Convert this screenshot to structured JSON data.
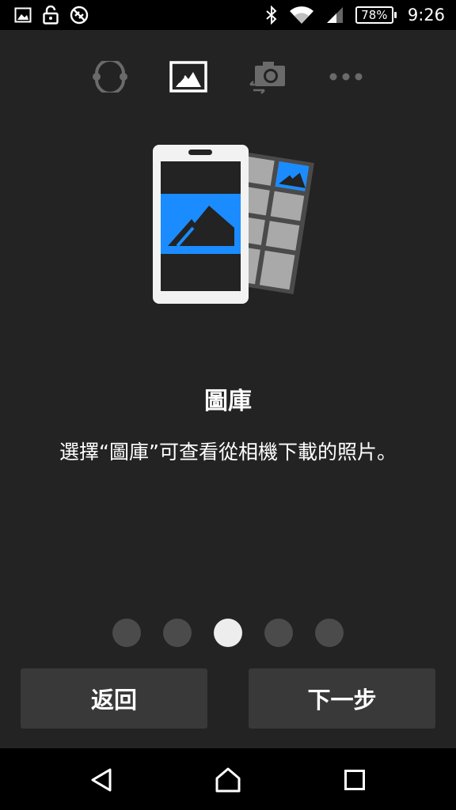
{
  "status_bar": {
    "battery_percent": "78%",
    "time": "9:26"
  },
  "mode_icons": [
    "sync-icon",
    "gallery-icon",
    "camera-switch-icon",
    "more-icon"
  ],
  "active_mode": "gallery-icon",
  "content": {
    "title": "圖庫",
    "description": "選擇“圖庫”可查看從相機下載的照片。"
  },
  "pagination": {
    "total": 5,
    "current_index": 2
  },
  "buttons": {
    "back_label": "返回",
    "next_label": "下一步"
  },
  "colors": {
    "accent": "#1a8cff",
    "background": "#232323",
    "button": "#393939"
  }
}
